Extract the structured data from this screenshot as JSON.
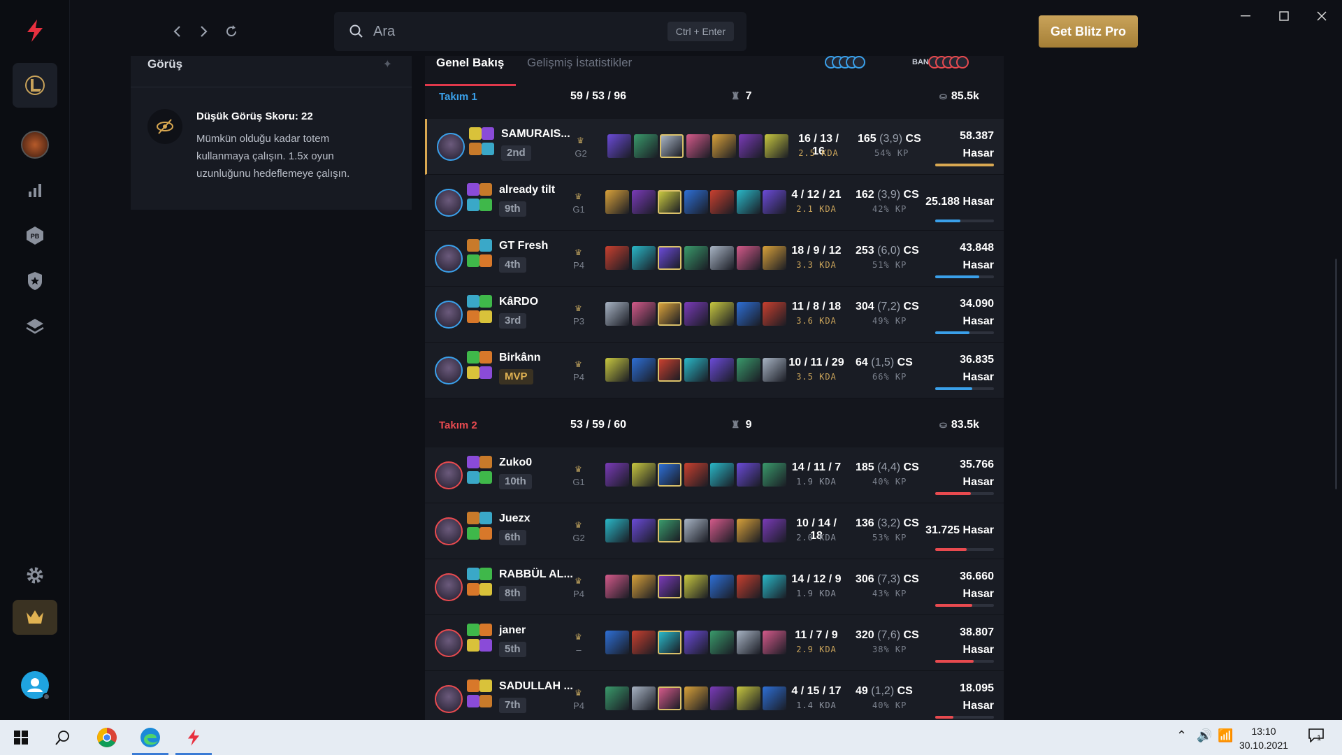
{
  "search": {
    "placeholder": "Ara",
    "shortcut": "Ctrl + Enter"
  },
  "header": {
    "pro_button": "Get Blitz Pro"
  },
  "vision": {
    "title": "Görüş",
    "heading": "Düşük Görüş Skoru: 22",
    "body": "Mümkün olduğu kadar totem kullanmaya çalışın. 1.5x oyun uzunluğunu hedeflemeye çalışın."
  },
  "tabs": {
    "overview": "Genel Bakış",
    "advanced": "Gelişmiş İstatistikler",
    "bans": "BANLAR"
  },
  "colors": {
    "team1": "#3aa0ea",
    "team2": "#e84a4f",
    "gold": "#d9a851",
    "accent": "#e0384b"
  },
  "teams": [
    {
      "name": "Takım 1",
      "kda": "59 / 53 / 96",
      "wards": "7",
      "gold": "85.5k",
      "players": [
        {
          "name": "SAMURAIS...",
          "rank": "2nd",
          "tier": "G2",
          "kda": "16 / 13 / 16",
          "ratio": "2.5 KDA",
          "cs": "165",
          "csm": "(3,9)",
          "kp": "54% KP",
          "damage": "58.387",
          "dmg_label": "Hasar",
          "dmg_fraction": 1.0
        },
        {
          "name": "already tilt",
          "rank": "9th",
          "tier": "G1",
          "kda": "4 / 12 / 21",
          "ratio": "2.1 KDA",
          "cs": "162",
          "csm": "(3,9)",
          "kp": "42% KP",
          "damage": "25.188",
          "dmg_label": "Hasar",
          "dmg_fraction": 0.43
        },
        {
          "name": "GT Fresh",
          "rank": "4th",
          "tier": "P4",
          "kda": "18 / 9 / 12",
          "ratio": "3.3 KDA",
          "cs": "253",
          "csm": "(6,0)",
          "kp": "51% KP",
          "damage": "43.848",
          "dmg_label": "Hasar",
          "dmg_fraction": 0.75
        },
        {
          "name": "KâRDO",
          "rank": "3rd",
          "tier": "P3",
          "kda": "11 / 8 / 18",
          "ratio": "3.6 KDA",
          "cs": "304",
          "csm": "(7,2)",
          "kp": "49% KP",
          "damage": "34.090",
          "dmg_label": "Hasar",
          "dmg_fraction": 0.58
        },
        {
          "name": "Birkânn",
          "rank": "MVP",
          "tier": "P4",
          "kda": "10 / 11 / 29",
          "ratio": "3.5 KDA",
          "cs": "64",
          "csm": "(1,5)",
          "kp": "66% KP",
          "damage": "36.835",
          "dmg_label": "Hasar",
          "dmg_fraction": 0.63
        }
      ]
    },
    {
      "name": "Takım 2",
      "kda": "53 / 59 / 60",
      "wards": "9",
      "gold": "83.5k",
      "players": [
        {
          "name": "Zuko0",
          "rank": "10th",
          "tier": "G1",
          "kda": "14 / 11 / 7",
          "ratio": "1.9 KDA",
          "cs": "185",
          "csm": "(4,4)",
          "kp": "40% KP",
          "damage": "35.766",
          "dmg_label": "Hasar",
          "dmg_fraction": 0.61
        },
        {
          "name": "Juezx",
          "rank": "6th",
          "tier": "G2",
          "kda": "10 / 14 / 18",
          "ratio": "2.0 KDA",
          "cs": "136",
          "csm": "(3,2)",
          "kp": "53% KP",
          "damage": "31.725",
          "dmg_label": "Hasar",
          "dmg_fraction": 0.54
        },
        {
          "name": "RABBÜL AL...",
          "rank": "8th",
          "tier": "P4",
          "kda": "14 / 12 / 9",
          "ratio": "1.9 KDA",
          "cs": "306",
          "csm": "(7,3)",
          "kp": "43% KP",
          "damage": "36.660",
          "dmg_label": "Hasar",
          "dmg_fraction": 0.63
        },
        {
          "name": "janer",
          "rank": "5th",
          "tier": "–",
          "kda": "11 / 7 / 9",
          "ratio": "2.9 KDA",
          "cs": "320",
          "csm": "(7,6)",
          "kp": "38% KP",
          "damage": "38.807",
          "dmg_label": "Hasar",
          "dmg_fraction": 0.66
        },
        {
          "name": "SADULLAH ...",
          "rank": "7th",
          "tier": "P4",
          "kda": "4 / 15 / 17",
          "ratio": "1.4 KDA",
          "cs": "49",
          "csm": "(1,2)",
          "kp": "40% KP",
          "damage": "18.095",
          "dmg_label": "Hasar",
          "dmg_fraction": 0.31
        }
      ]
    }
  ],
  "taskbar": {
    "time": "13:10",
    "date": "30.10.2021",
    "notifications": "1"
  }
}
